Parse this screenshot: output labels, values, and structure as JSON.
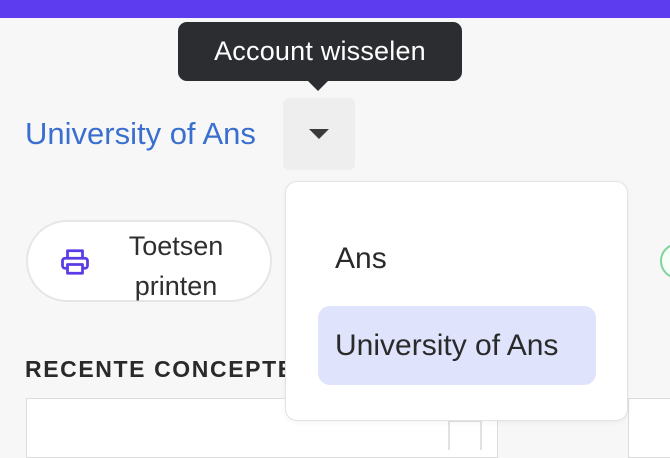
{
  "tooltip": {
    "text": "Account wisselen"
  },
  "account": {
    "current_name": "University of Ans"
  },
  "toolbar": {
    "print_label_line1": "Toetsen",
    "print_label_line2": "printen"
  },
  "section": {
    "title": "RECENTE CONCEPTE"
  },
  "menu": {
    "items": [
      {
        "label": "Ans",
        "selected": false
      },
      {
        "label": "University of Ans",
        "selected": true
      }
    ]
  },
  "colors": {
    "topbar": "#5d3cf0",
    "accent_text": "#3a6fd0",
    "tooltip_bg": "#2b2d31",
    "selected_item_bg": "#dfe3fb",
    "icon": "#5a3be6"
  },
  "icons": {
    "print": "printer-icon",
    "dropdown": "caret-down-icon"
  }
}
